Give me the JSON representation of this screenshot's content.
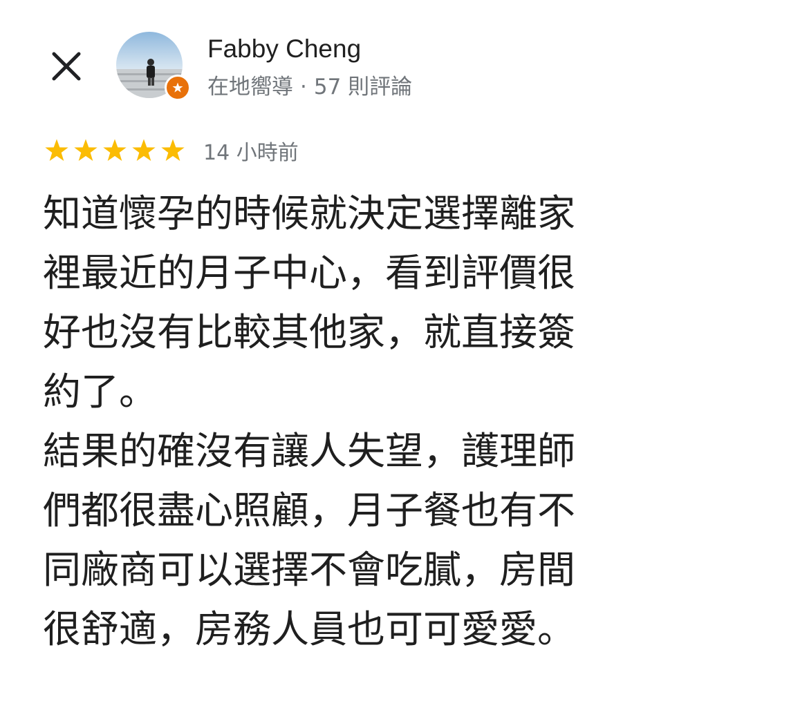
{
  "header": {
    "close_icon": "close-icon",
    "reviewer": {
      "name": "Fabby Cheng",
      "role": "在地嚮導",
      "separator": "·",
      "review_count": "57 則評論",
      "avatar_icon": "avatar-photo",
      "badge_icon": "local-guide-star-icon",
      "badge_color": "#e8710a"
    }
  },
  "review": {
    "rating": 5,
    "rating_max": 5,
    "star_color": "#fbbc04",
    "time": "14 小時前",
    "lines": [
      "知道懷孕的時候就決定選擇離家",
      "裡最近的月子中心，看到評價很",
      "好也沒有比較其他家，就直接簽",
      "約了。",
      "結果的確沒有讓人失望，護理師",
      "們都很盡心照顧，月子餐也有不",
      "同廠商可以選擇不會吃膩，房間",
      "很舒適，房務人員也可可愛愛。"
    ]
  }
}
